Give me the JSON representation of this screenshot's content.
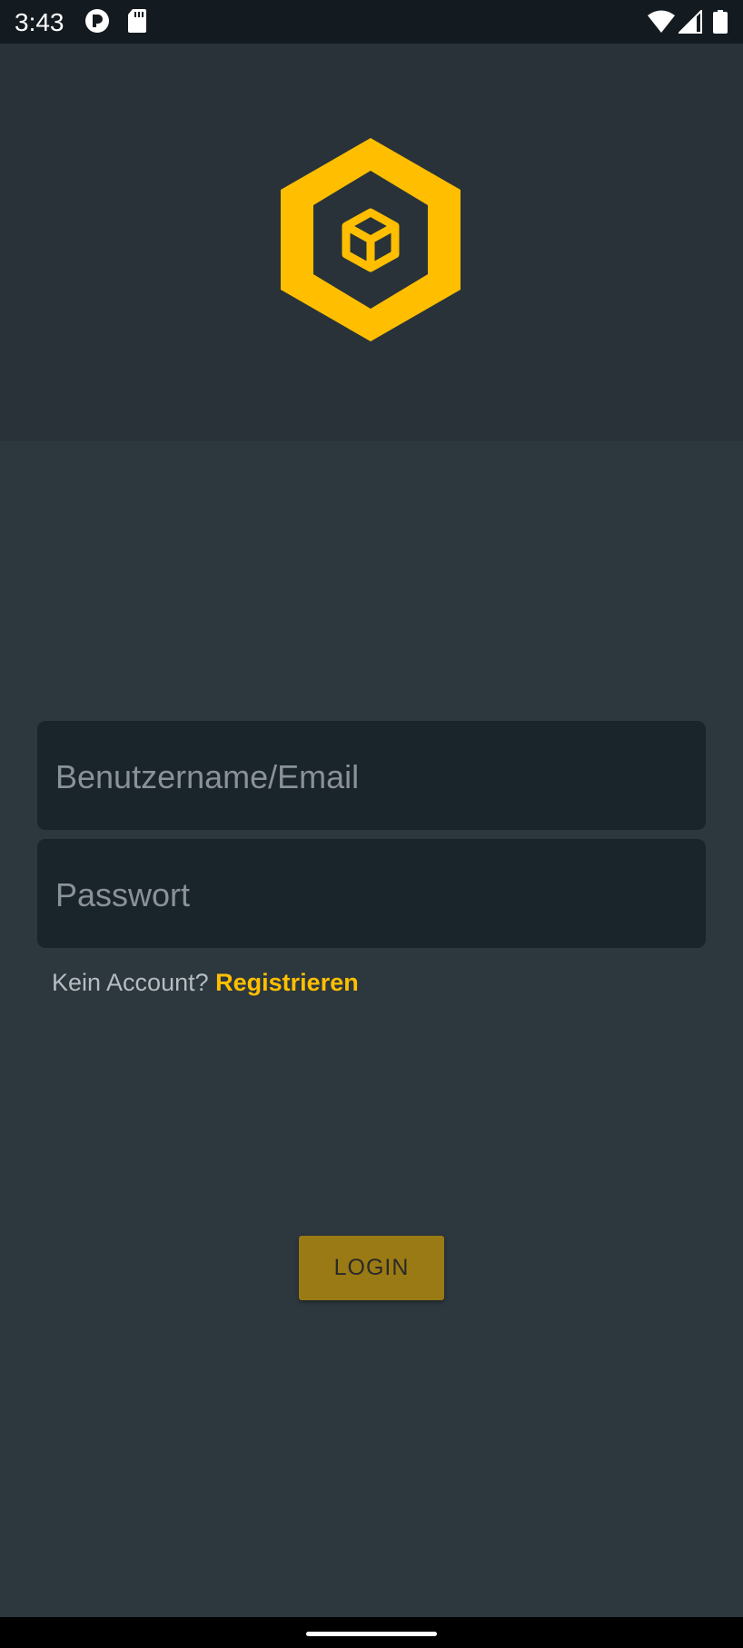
{
  "status_bar": {
    "time": "3:43",
    "icons": [
      "data-saver-icon",
      "sd-card-icon",
      "wifi-icon",
      "cell-signal-icon",
      "battery-icon"
    ]
  },
  "header": {
    "logo": "hexagon-cube-logo",
    "accent_color": "#ffbf00"
  },
  "login_form": {
    "username_placeholder": "Benutzername/Email",
    "username_value": "",
    "password_placeholder": "Passwort",
    "password_value": "",
    "register_prompt": "Kein Account?",
    "register_link": "Registrieren",
    "login_button": "LOGIN"
  },
  "colors": {
    "background": "#2c373e",
    "header_background": "#283238",
    "field_background": "#1a242b",
    "accent": "#ffbf00",
    "button_background": "#9a7a14"
  }
}
